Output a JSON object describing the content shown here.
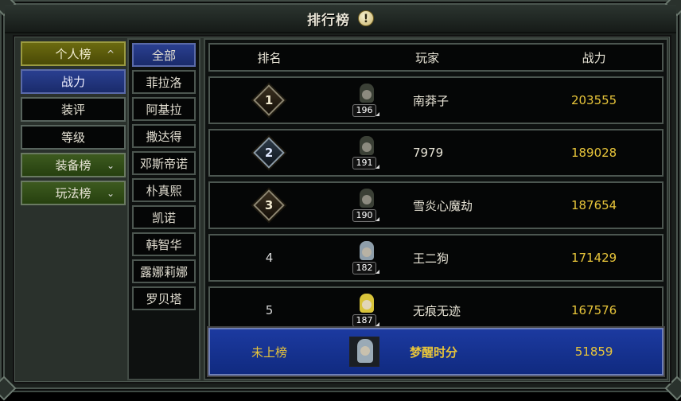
{
  "window": {
    "title": "排行榜"
  },
  "categories": [
    {
      "label": "个人榜",
      "type": "group",
      "state": "open",
      "chevron": "^"
    },
    {
      "label": "战力",
      "type": "item",
      "state": "active"
    },
    {
      "label": "装评",
      "type": "item",
      "state": "normal"
    },
    {
      "label": "等级",
      "type": "item",
      "state": "normal"
    },
    {
      "label": "装备榜",
      "type": "group",
      "state": "closed",
      "chevron": "⌄"
    },
    {
      "label": "玩法榜",
      "type": "group",
      "state": "closed",
      "chevron": "⌄"
    }
  ],
  "filters": [
    "全部",
    "菲拉洛",
    "阿基拉",
    "撒达得",
    "邓斯帝诺",
    "朴真熙",
    "凯诺",
    "韩智华",
    "露娜莉娜",
    "罗贝塔"
  ],
  "table": {
    "headers": {
      "rank": "排名",
      "player": "玩家",
      "power": "战力"
    },
    "rows": [
      {
        "rank": "1",
        "medal": "gold",
        "level": "196",
        "name": "南莽子",
        "power": "203555",
        "avatar": "dark"
      },
      {
        "rank": "2",
        "medal": "silver",
        "level": "191",
        "name": "7979",
        "power": "189028",
        "avatar": "dark"
      },
      {
        "rank": "3",
        "medal": "bronze",
        "level": "190",
        "name": "雪炎心魔劫",
        "power": "187654",
        "avatar": "dark"
      },
      {
        "rank": "4",
        "medal": "",
        "level": "182",
        "name": "王二狗",
        "power": "171429",
        "avatar": "silver"
      },
      {
        "rank": "5",
        "medal": "",
        "level": "187",
        "name": "无痕无迹",
        "power": "167576",
        "avatar": "gold"
      }
    ],
    "self": {
      "rank": "未上榜",
      "name": "梦醒时分",
      "power": "51859"
    }
  },
  "colors": {
    "accent_gold": "#e8c53a",
    "active_blue": "#1a2b6b",
    "group_green": "#3d5a1f"
  }
}
